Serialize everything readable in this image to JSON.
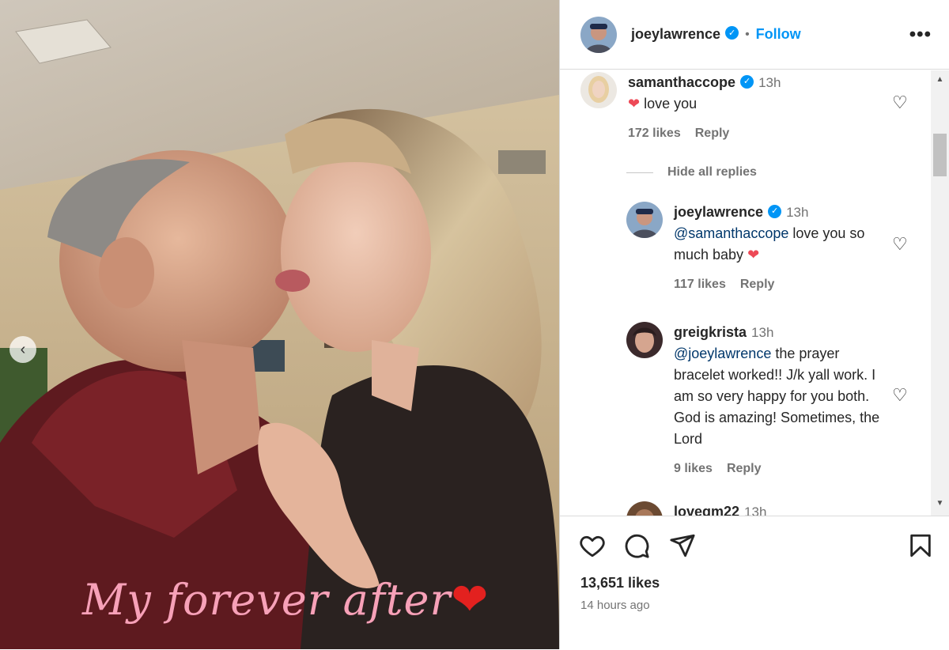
{
  "post": {
    "overlay_text": "My forever after",
    "overlay_emoji": "❤"
  },
  "header": {
    "username": "joeylawrence",
    "verified_icon": "verified-badge-icon",
    "separator": "•",
    "follow_label": "Follow",
    "more_label": "•••"
  },
  "comments": [
    {
      "username": "samanthaccope",
      "verified": true,
      "time": "13h",
      "text_prefix": "❤",
      "text": " love you",
      "likes": "172 likes",
      "reply": "Reply"
    },
    {
      "username": "joeylawrence",
      "verified": true,
      "time": "13h",
      "mention": "@samanthaccope",
      "text": " love you so much baby ",
      "text_suffix": "❤",
      "likes": "117 likes",
      "reply": "Reply"
    },
    {
      "username": "greigkrista",
      "verified": false,
      "time": "13h",
      "mention": "@joeylawrence",
      "text": " the prayer bracelet worked!! J/k yall work. I am so very happy for you both. God is amazing! Sometimes, the Lord",
      "likes": "9 likes",
      "reply": "Reply"
    },
    {
      "username": "lovegm22",
      "time": "13h"
    }
  ],
  "hide_replies_label": "Hide all replies",
  "footer": {
    "likes": "13,651 likes",
    "time_ago": "14 hours ago"
  },
  "colors": {
    "accent": "#0095f6",
    "heart": "#ed4956",
    "overlay_pink": "#f7a1b8"
  }
}
